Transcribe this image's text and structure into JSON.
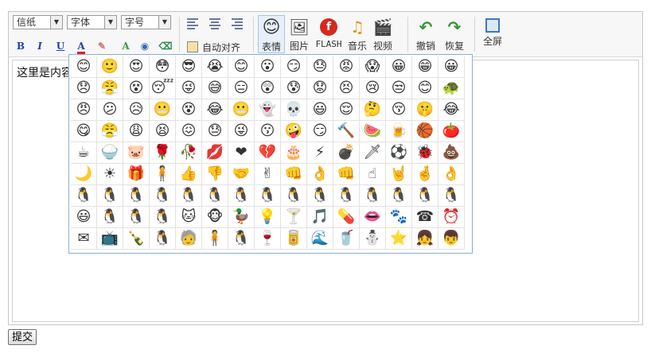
{
  "toolbar": {
    "font_family": "信纸",
    "font_name": "字体",
    "font_size": "字号",
    "bold": "B",
    "italic": "I",
    "underline": "U",
    "font_color": "A",
    "auto_align": "自动对齐",
    "buttons": {
      "emoticon": "表情",
      "image": "图片",
      "flash": "FLASH",
      "music": "音乐",
      "video": "视频",
      "undo": "撤销",
      "redo": "恢复",
      "fullscreen": "全屏"
    }
  },
  "content": {
    "text": "这里是内容"
  },
  "emoticons": [
    "😊",
    "🙂",
    "😍",
    "😳",
    "😎",
    "😭",
    "😊",
    "😮",
    "😏",
    "😓",
    "😡",
    "😱",
    "😀",
    "😁",
    "😀",
    "😞",
    "😤",
    "😵",
    "😴",
    "😜",
    "😅",
    "😑",
    "😲",
    "😰",
    "😟",
    "😣",
    "😢",
    "😒",
    "😊",
    "🐢",
    "😠",
    "😕",
    "😥",
    "😬",
    "😵",
    "😂",
    "😬",
    "👻",
    "💀",
    "😃",
    "😌",
    "🤔",
    "😚",
    "🤫",
    "😂",
    "😋",
    "😤",
    "😩",
    "😫",
    "😖",
    "😓",
    "😜",
    "😗",
    "🤪",
    "😏",
    "🔨",
    "🍉",
    "🍺",
    "🏀",
    "🍅",
    "☕",
    "🍚",
    "🐷",
    "🌹",
    "🥀",
    "💋",
    "❤",
    "💔",
    "🎂",
    "⚡",
    "💣",
    "🗡",
    "⚽",
    "🐞",
    "💩",
    "🌙",
    "☀",
    "🎁",
    "🧍",
    "👍",
    "👎",
    "🤝",
    "✌",
    "👊",
    "👌",
    "👊",
    "☝",
    "🤘",
    "🤞",
    "👌",
    "🐧",
    "🐧",
    "🐧",
    "🐧",
    "🐧",
    "🐧",
    "🐧",
    "🐧",
    "🐧",
    "🐧",
    "🐧",
    "🐧",
    "🐧",
    "🐧",
    "🐧",
    "😃",
    "🐧",
    "🐧",
    "🐧",
    "🐱",
    "🐵",
    "🦆",
    "💡",
    "🍸",
    "🎵",
    "💊",
    "👄",
    "🐾",
    "☎",
    "⏰",
    "✉",
    "📺",
    "🍾",
    "🐧",
    "🧓",
    "🧍",
    "🐧",
    "🍷",
    "🥫",
    "🌊",
    "🥤",
    "⛄",
    "⭐",
    "👧",
    "👦"
  ],
  "submit": "提交"
}
